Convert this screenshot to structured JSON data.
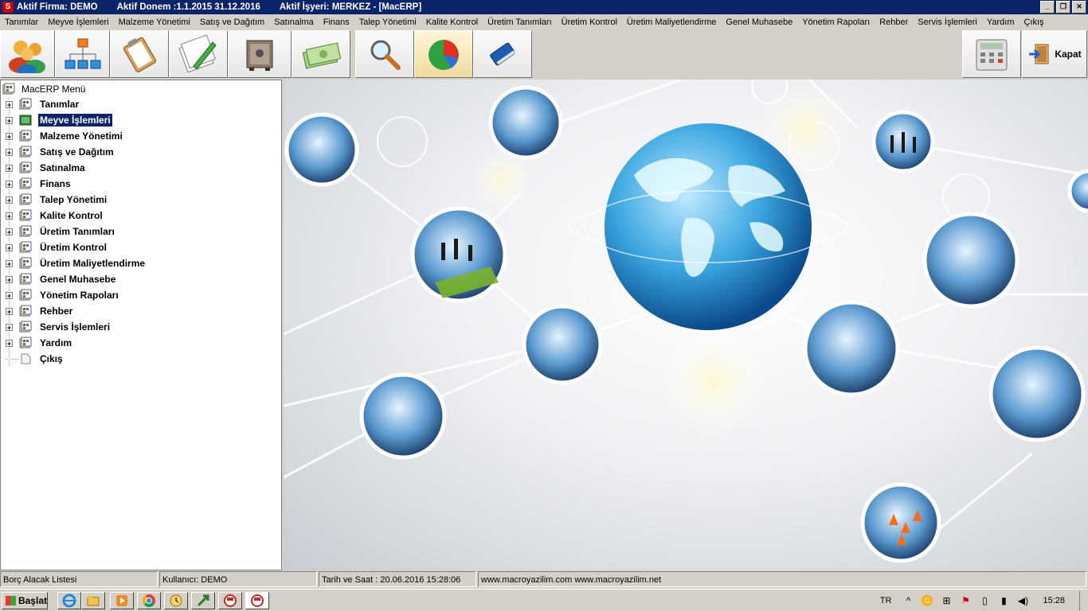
{
  "titlebar": {
    "firma": "Aktif Firma: DEMO",
    "donem": "Aktif Donem :1.1.2015  31.12.2016",
    "isyeri": "Aktif İşyeri: MERKEZ - [MacERP]"
  },
  "menu": [
    "Tanımlar",
    "Meyve İşlemleri",
    "Malzeme Yönetimi",
    "Satış ve Dağıtım",
    "Satınalma",
    "Finans",
    "Talep Yönetimi",
    "Kalite Kontrol",
    "Üretim Tanımları",
    "Üretim Kontrol",
    "Üretim Maliyetlendirme",
    "Genel Muhasebe",
    "Yönetim Rapoları",
    "Rehber",
    "Servis İşlemleri",
    "Yardım",
    "Çıkış"
  ],
  "toolbar": {
    "buttons": [
      "users-icon",
      "org-chart-icon",
      "clipboard-icon",
      "pencil-notes-icon",
      "safe-icon",
      "money-icon",
      "search-icon",
      "pie-chart-icon",
      "book-icon"
    ],
    "calculator": "calculator-icon",
    "close_label": "Kapat"
  },
  "tree": {
    "root": "MacERP Menü",
    "items": [
      "Tanımlar",
      "Meyve İşlemleri",
      "Malzeme Yönetimi",
      "Satış ve Dağıtım",
      "Satınalma",
      "Finans",
      "Talep Yönetimi",
      "Kalite Kontrol",
      "Üretim Tanımları",
      "Üretim Kontrol",
      "Üretim Maliyetlendirme",
      "Genel Muhasebe",
      "Yönetim Rapoları",
      "Rehber",
      "Servis İşlemleri",
      "Yardım"
    ],
    "selected_index": 1,
    "exit": "Çıkış"
  },
  "status": {
    "report": "Borç Alacak Listesi",
    "user": "Kullanıcı: DEMO",
    "datetime": "Tarih ve Saat : 20.06.2016 15:28:06",
    "web": "www.macroyazilim.com  www.macroyazilim.net"
  },
  "taskbar": {
    "start": "Başlat",
    "lang": "TR",
    "clock": "15:28"
  }
}
